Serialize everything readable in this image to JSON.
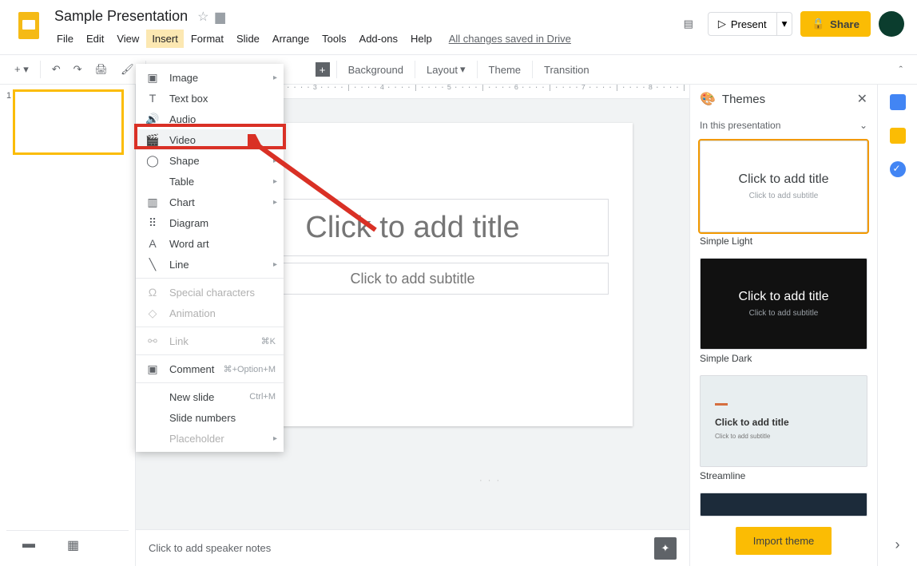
{
  "doc_title": "Sample Presentation",
  "menus": [
    "File",
    "Edit",
    "View",
    "Insert",
    "Format",
    "Slide",
    "Arrange",
    "Tools",
    "Add-ons",
    "Help"
  ],
  "active_menu_index": 3,
  "save_status": "All changes saved in Drive",
  "header": {
    "present": "Present",
    "share": "Share"
  },
  "toolbar": {
    "background": "Background",
    "layout": "Layout",
    "theme": "Theme",
    "transition": "Transition"
  },
  "dropdown": {
    "image": "Image",
    "textbox": "Text box",
    "audio": "Audio",
    "video": "Video",
    "shape": "Shape",
    "table": "Table",
    "chart": "Chart",
    "diagram": "Diagram",
    "wordart": "Word art",
    "line": "Line",
    "special": "Special characters",
    "animation": "Animation",
    "link": "Link",
    "link_shortcut": "⌘K",
    "comment": "Comment",
    "comment_shortcut": "⌘+Option+M",
    "newslide": "New slide",
    "newslide_shortcut": "Ctrl+M",
    "slidenumbers": "Slide numbers",
    "placeholder": "Placeholder"
  },
  "slide_number": "1",
  "canvas": {
    "title_placeholder": "Click to add title",
    "subtitle_placeholder": "Click to add subtitle"
  },
  "notes_placeholder": "Click to add speaker notes",
  "ruler_text": "····1····|····2····|····3····|····4····|····5····|····6····|····7····|····8····|····9····|",
  "themes": {
    "title": "Themes",
    "subtitle": "In this presentation",
    "items": [
      {
        "name": "Simple Light",
        "title": "Click to add title",
        "sub": "Click to add subtitle",
        "mode": "light"
      },
      {
        "name": "Simple Dark",
        "title": "Click to add title",
        "sub": "Click to add subtitle",
        "mode": "dark"
      },
      {
        "name": "Streamline",
        "title": "Click to add title",
        "sub": "Click to add subtitle",
        "mode": "streamline"
      }
    ],
    "import_label": "Import theme"
  }
}
